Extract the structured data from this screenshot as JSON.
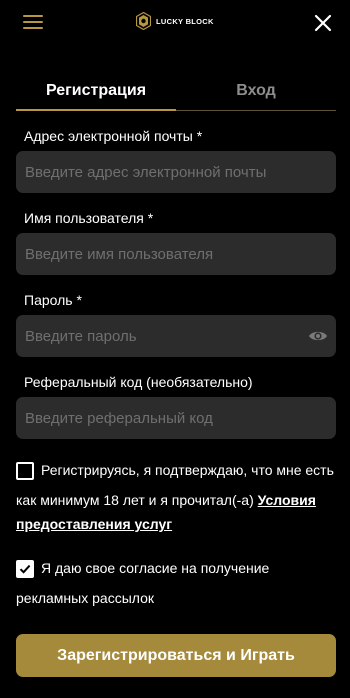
{
  "header": {
    "brand": "LUCKY BLOCK",
    "menu_icon": "hamburger-menu-icon",
    "logo_icon": "lucky-block-logo-icon",
    "close_icon": "close-icon",
    "accent_color": "#b9973f"
  },
  "tabs": [
    {
      "label": "Регистрация",
      "active": true
    },
    {
      "label": "Вход",
      "active": false
    }
  ],
  "form": {
    "email": {
      "label": "Адрес электронной почты *",
      "placeholder": "Введите адрес электронной почты",
      "value": ""
    },
    "username": {
      "label": "Имя пользователя *",
      "placeholder": "Введите имя пользователя",
      "value": ""
    },
    "password": {
      "label": "Пароль *",
      "placeholder": "Введите пароль",
      "value": "",
      "toggle_icon": "eye-icon"
    },
    "referral": {
      "label": "Реферальный код (необязательно)",
      "placeholder": "Введите реферальный код",
      "value": ""
    }
  },
  "consents": {
    "terms": {
      "checked": false,
      "line1": "Регистрируясь, я подтверждаю, что мне есть",
      "line2_prefix": "как минимум 18 лет и я прочитал(-а)",
      "link_part1": "Условия",
      "link_part2": "предоставления услуг"
    },
    "marketing": {
      "checked": true,
      "line1": "Я даю свое согласие на получение",
      "line2": "рекламных рассылок"
    }
  },
  "submit_label": "Зарегистрироваться и Играть",
  "button_color": "#a58a3b"
}
